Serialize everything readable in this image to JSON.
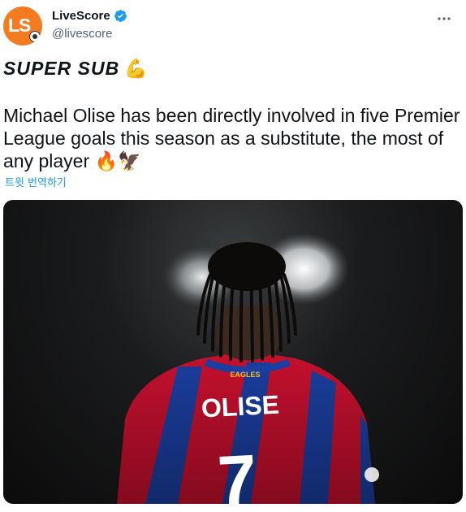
{
  "tweet": {
    "author": {
      "display_name": "LiveScore",
      "handle": "@livescore",
      "avatar_text": "LS",
      "verified": true,
      "verified_color": "#1d9bf0",
      "brand_color": "#f47b20"
    },
    "more_icon": "more-horizontal-icon",
    "headline": "SUPER SUB",
    "headline_emoji": "💪",
    "body": "Michael Olise has been directly involved in five Premier League goals this season as a substitute, the most of any player 🔥🦅",
    "translate_label": "트윗 번역하기",
    "link_color": "#1d9bf0",
    "media": {
      "type": "photo",
      "jersey_sponsor_text": "EAGLES",
      "jersey_name": "OLISE",
      "jersey_number": "7"
    }
  }
}
